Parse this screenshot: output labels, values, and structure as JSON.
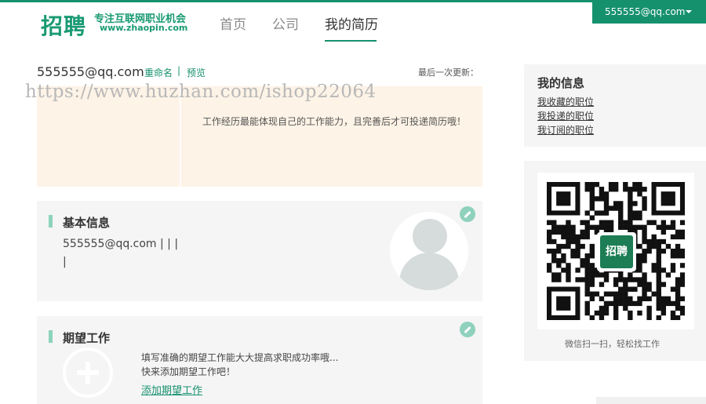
{
  "header": {
    "logo_main": "招聘",
    "logo_slogan": "专注互联网职业机会",
    "logo_url": "www.zhaopin.com",
    "nav": {
      "home": "首页",
      "company": "公司",
      "resume": "我的简历"
    },
    "user_email": "555555@qq.com"
  },
  "watermark": "https://www.huzhan.com/ishop22064",
  "resume": {
    "name": "555555@qq.com",
    "rename_label": "重命名",
    "separator": "|",
    "preview_label": "预览",
    "last_update_label": "最后一次更新：",
    "progress_tip": "工作经历最能体现自己的工作能力，且完善后才可投递简历哦！"
  },
  "basic_info": {
    "title": "基本信息",
    "line1": "555555@qq.com | | |",
    "line2": "|"
  },
  "expect_job": {
    "title": "期望工作",
    "tip1": "填写准确的期望工作能大大提高求职成功率哦...",
    "tip2": "快来添加期望工作吧！",
    "add_link": "添加期望工作"
  },
  "sidebar": {
    "title": "我的信息",
    "links": [
      "我收藏的职位",
      "我投递的职位",
      "我订阅的职位"
    ],
    "qr_logo_text": "招聘",
    "qr_caption": "微信扫一扫，轻松找工作"
  },
  "colors": {
    "brand": "#16916e",
    "accent_light": "#8cd3bc",
    "progress_bg": "#fdf3e6",
    "section_bg": "#f5f5f5"
  }
}
